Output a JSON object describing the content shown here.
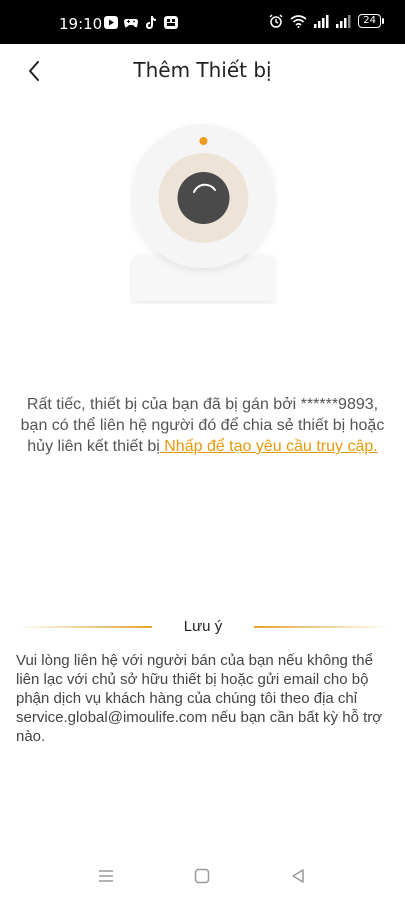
{
  "status_bar": {
    "time": "19:10",
    "battery": "24",
    "left_icons": [
      "play-icon",
      "gamepad-icon",
      "tiktok-icon",
      "app-icon"
    ],
    "right_icons": [
      "alarm-icon",
      "wifi-icon",
      "signal-icon",
      "signal-icon"
    ]
  },
  "header": {
    "title": "Thêm Thiết bị",
    "back_icon": "chevron-left-icon"
  },
  "illustration": {
    "icon": "camera-icon",
    "indicator_color": "#f29a1e"
  },
  "message": {
    "text": "Rất tiếc, thiết bị của bạn đã bị gán bởi ******9893, bạn có thể liên hệ người đó để chia sẻ thiết bị hoặc hủy liên kết thiết bị",
    "link": " Nhấp để tạo yêu cầu truy cập."
  },
  "note": {
    "title": "Lưu ý",
    "body": "Vui lòng liên hệ với người bán của bạn nếu không thể liên lạc với chủ sở hữu thiết bị hoặc gửi email cho bộ phận dịch vụ khách hàng của chúng tôi theo địa chỉ service.global@imoulife.com nếu bạn cần bất kỳ hỗ trợ nào."
  },
  "nav_bar": {
    "icons": [
      "menu-icon",
      "home-square-icon",
      "back-triangle-icon"
    ]
  },
  "colors": {
    "accent": "#e19a0c",
    "status_bar_bg": "#000000",
    "text": "#555555"
  }
}
